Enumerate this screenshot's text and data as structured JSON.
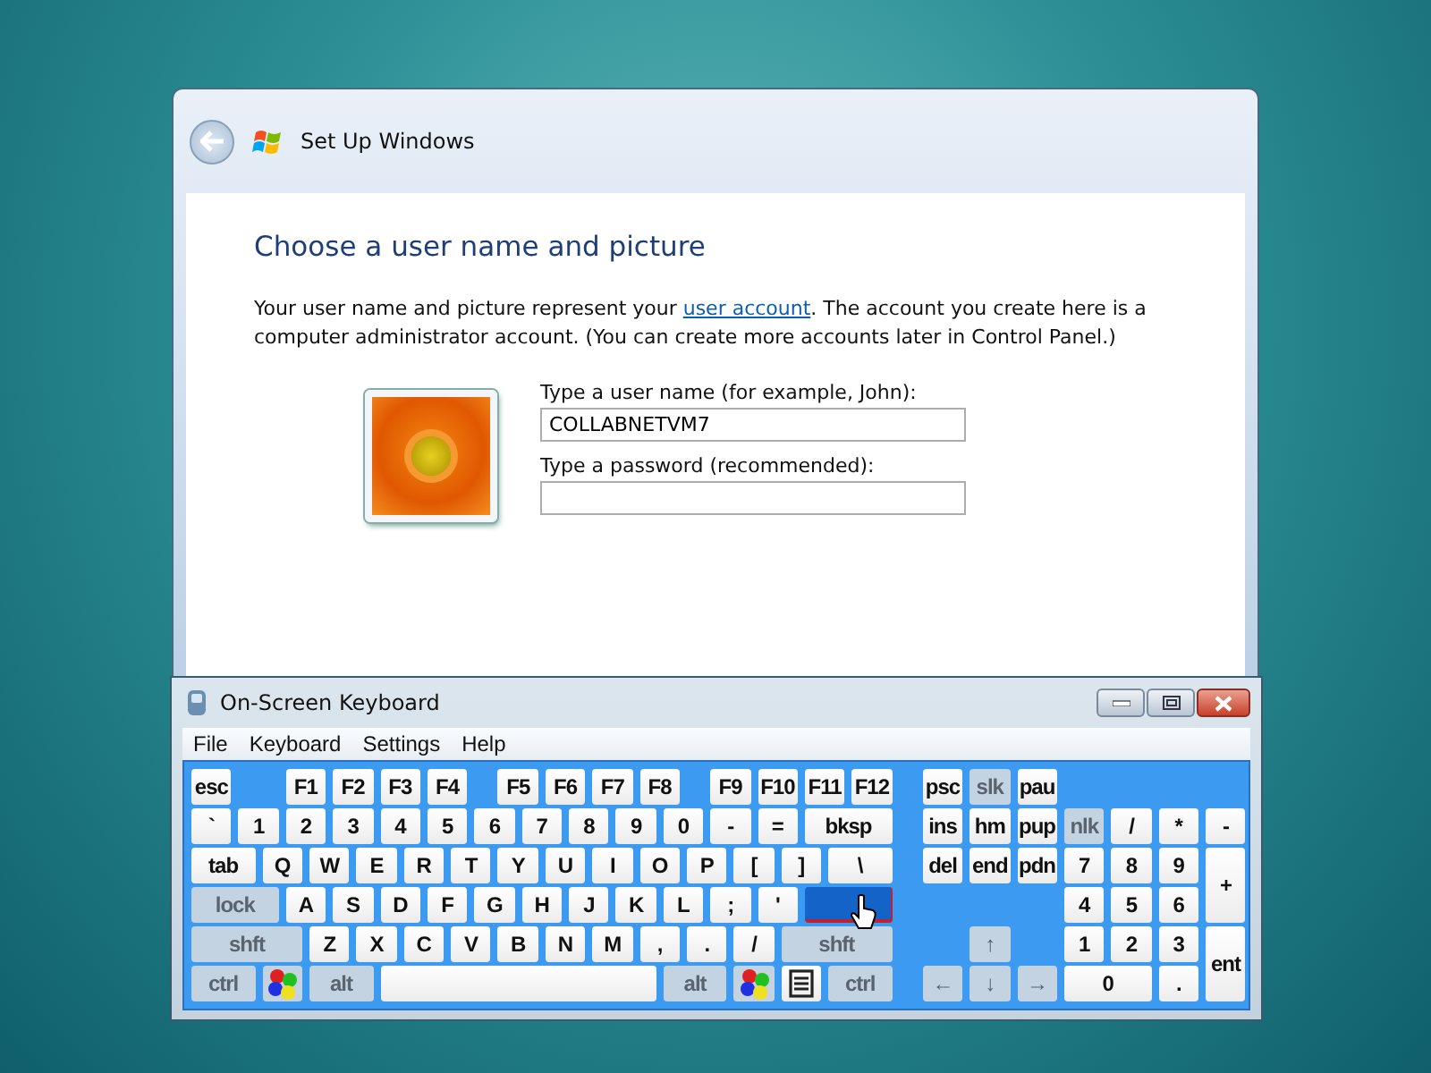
{
  "setup_window": {
    "title": "Set Up Windows",
    "heading": "Choose a user name and picture",
    "intro_before": "Your user name and picture represent your ",
    "intro_link": "user account",
    "intro_after": ". The account you create here is a computer administrator account. (You can create more accounts later in Control Panel.)",
    "username_label": "Type a user name (for example, John):",
    "username_value": "COLLABNETVM7",
    "password_label": "Type a password (recommended):"
  },
  "keyboard_window": {
    "title": "On-Screen Keyboard",
    "menu": [
      "File",
      "Keyboard",
      "Settings",
      "Help"
    ],
    "rows": [
      {
        "keys": [
          {
            "label": "esc",
            "kind": "key"
          },
          {
            "label": "F1",
            "kind": "key"
          },
          {
            "label": "F2",
            "kind": "key"
          },
          {
            "label": "F3",
            "kind": "key"
          },
          {
            "label": "F4",
            "kind": "key"
          },
          {
            "label": "F5",
            "kind": "key"
          },
          {
            "label": "F6",
            "kind": "key"
          },
          {
            "label": "F7",
            "kind": "key"
          },
          {
            "label": "F8",
            "kind": "key"
          },
          {
            "label": "F9",
            "kind": "key"
          },
          {
            "label": "F10",
            "kind": "key"
          },
          {
            "label": "F11",
            "kind": "key"
          },
          {
            "label": "F12",
            "kind": "key"
          },
          {
            "label": "psc",
            "kind": "key"
          },
          {
            "label": "slk",
            "kind": "toggle"
          },
          {
            "label": "pau",
            "kind": "key"
          }
        ]
      },
      {
        "keys": [
          {
            "label": "`",
            "kind": "key"
          },
          {
            "label": "1",
            "kind": "key"
          },
          {
            "label": "2",
            "kind": "key"
          },
          {
            "label": "3",
            "kind": "key"
          },
          {
            "label": "4",
            "kind": "key"
          },
          {
            "label": "5",
            "kind": "key"
          },
          {
            "label": "6",
            "kind": "key"
          },
          {
            "label": "7",
            "kind": "key"
          },
          {
            "label": "8",
            "kind": "key"
          },
          {
            "label": "9",
            "kind": "key"
          },
          {
            "label": "0",
            "kind": "key"
          },
          {
            "label": "-",
            "kind": "key"
          },
          {
            "label": "=",
            "kind": "key"
          },
          {
            "label": "bksp",
            "kind": "key"
          },
          {
            "label": "ins",
            "kind": "key"
          },
          {
            "label": "hm",
            "kind": "key"
          },
          {
            "label": "pup",
            "kind": "key"
          },
          {
            "label": "nlk",
            "kind": "toggle"
          },
          {
            "label": "/",
            "kind": "key"
          },
          {
            "label": "*",
            "kind": "key"
          },
          {
            "label": "-",
            "kind": "key"
          }
        ]
      },
      {
        "keys": [
          {
            "label": "tab",
            "kind": "key"
          },
          {
            "label": "Q",
            "kind": "key"
          },
          {
            "label": "W",
            "kind": "key"
          },
          {
            "label": "E",
            "kind": "key"
          },
          {
            "label": "R",
            "kind": "key"
          },
          {
            "label": "T",
            "kind": "key"
          },
          {
            "label": "Y",
            "kind": "key"
          },
          {
            "label": "U",
            "kind": "key"
          },
          {
            "label": "I",
            "kind": "key"
          },
          {
            "label": "O",
            "kind": "key"
          },
          {
            "label": "P",
            "kind": "key"
          },
          {
            "label": "[",
            "kind": "key"
          },
          {
            "label": "]",
            "kind": "key"
          },
          {
            "label": "\\",
            "kind": "key"
          },
          {
            "label": "del",
            "kind": "key"
          },
          {
            "label": "end",
            "kind": "key"
          },
          {
            "label": "pdn",
            "kind": "key"
          },
          {
            "label": "7",
            "kind": "key"
          },
          {
            "label": "8",
            "kind": "key"
          },
          {
            "label": "9",
            "kind": "key"
          },
          {
            "label": "+",
            "kind": "key"
          }
        ]
      },
      {
        "keys": [
          {
            "label": "lock",
            "kind": "toggle"
          },
          {
            "label": "A",
            "kind": "key"
          },
          {
            "label": "S",
            "kind": "key"
          },
          {
            "label": "D",
            "kind": "key"
          },
          {
            "label": "F",
            "kind": "key"
          },
          {
            "label": "G",
            "kind": "key"
          },
          {
            "label": "H",
            "kind": "key"
          },
          {
            "label": "J",
            "kind": "key"
          },
          {
            "label": "K",
            "kind": "key"
          },
          {
            "label": "L",
            "kind": "key"
          },
          {
            "label": ";",
            "kind": "key"
          },
          {
            "label": "'",
            "kind": "key"
          },
          {
            "kind": "hover"
          },
          {
            "label": "4",
            "kind": "key"
          },
          {
            "label": "5",
            "kind": "key"
          },
          {
            "label": "6",
            "kind": "key"
          }
        ]
      },
      {
        "keys": [
          {
            "label": "shft",
            "kind": "toggle"
          },
          {
            "label": "Z",
            "kind": "key"
          },
          {
            "label": "X",
            "kind": "key"
          },
          {
            "label": "C",
            "kind": "key"
          },
          {
            "label": "V",
            "kind": "key"
          },
          {
            "label": "B",
            "kind": "key"
          },
          {
            "label": "N",
            "kind": "key"
          },
          {
            "label": "M",
            "kind": "key"
          },
          {
            "label": ",",
            "kind": "key"
          },
          {
            "label": ".",
            "kind": "key"
          },
          {
            "label": "/",
            "kind": "key"
          },
          {
            "label": "shft",
            "kind": "toggle"
          },
          {
            "label": "↑",
            "kind": "toggle"
          },
          {
            "label": "1",
            "kind": "key"
          },
          {
            "label": "2",
            "kind": "key"
          },
          {
            "label": "3",
            "kind": "key"
          },
          {
            "label": "ent",
            "kind": "key"
          }
        ]
      },
      {
        "keys": [
          {
            "label": "ctrl",
            "kind": "toggle"
          },
          {
            "kind": "win"
          },
          {
            "label": "alt",
            "kind": "toggle"
          },
          {
            "kind": "space"
          },
          {
            "label": "alt",
            "kind": "toggle"
          },
          {
            "kind": "win"
          },
          {
            "kind": "menu"
          },
          {
            "label": "ctrl",
            "kind": "toggle"
          },
          {
            "label": "←",
            "kind": "toggle"
          },
          {
            "label": "↓",
            "kind": "toggle"
          },
          {
            "label": "→",
            "kind": "toggle"
          },
          {
            "label": "0",
            "kind": "key"
          },
          {
            "label": ".",
            "kind": "key"
          }
        ]
      }
    ]
  }
}
